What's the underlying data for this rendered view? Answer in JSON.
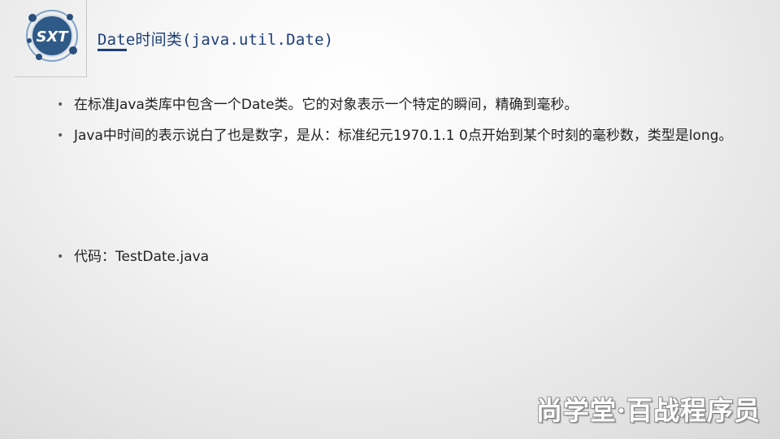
{
  "logo": {
    "text": "SXT",
    "colors": {
      "circle": "#2f5a88",
      "ring": "#7fa2c6",
      "dots": "#2c4f7d"
    }
  },
  "slide": {
    "title": "Date时间类(java.util.Date)",
    "bullets": [
      "在标准Java类库中包含一个Date类。它的对象表示一个特定的瞬间，精确到毫秒。",
      "Java中时间的表示说白了也是数字，是从：标准纪元1970.1.1 0点开始到某个时刻的毫秒数，类型是long。"
    ],
    "code_bullet": "代码：TestDate.java",
    "bullet_glyph": "•"
  },
  "watermark": "尚学堂·百战程序员",
  "colors": {
    "title": "#1e3f7a",
    "text": "#222222"
  }
}
